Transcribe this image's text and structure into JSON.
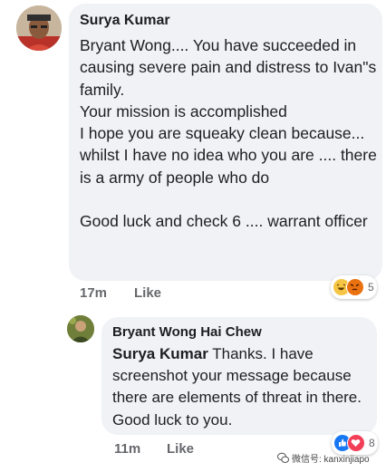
{
  "comment": {
    "author": "Surya Kumar",
    "text": "Bryant Wong.... You have succeeded in causing severe pain and distress to Ivan\"s family.\nYour mission is accomplished\nI hope you are squeaky clean because... whilst I have no idea who you are .... there is a army of people who do\n\nGood luck and check 6 .... warrant officer",
    "time": "17m",
    "like_label": "Like",
    "reaction_icons": [
      "haha-icon",
      "angry-icon"
    ],
    "reaction_count": "5"
  },
  "reply": {
    "author": "Bryant Wong Hai Chew",
    "mention": "Surya Kumar",
    "text": " Thanks. I have screenshot your message because there are elements of threat in there. Good luck to you.",
    "time": "11m",
    "like_label": "Like",
    "reaction_icons": [
      "like-icon",
      "love-icon"
    ],
    "reaction_count": "8"
  },
  "watermark": {
    "text": "微信号: kanxinjiapo",
    "icon": "wechat-icon"
  },
  "colors": {
    "bubble": "#f0f2f5",
    "meta_text": "#65676b",
    "like_blue": "#1877f2",
    "love_red": "#f33e58",
    "haha_yellow": "#f7c545",
    "angry_orange": "#e9710f"
  }
}
